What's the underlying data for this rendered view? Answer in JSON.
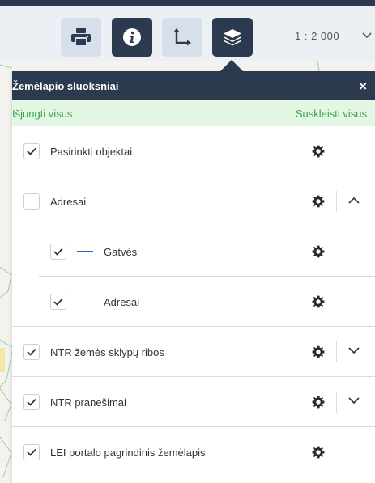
{
  "toolbar": {
    "tools": [
      {
        "icon": "printer-icon"
      },
      {
        "icon": "info-icon"
      },
      {
        "icon": "measure-icon"
      },
      {
        "icon": "layers-icon"
      }
    ],
    "scale_value": "1 : 2 000",
    "scale_icon": "chevron-down-icon"
  },
  "colors": {
    "header": "#2b3a4f",
    "accent_green": "#3aa34a",
    "actions_bg": "#e3f7e4",
    "street_line": "#2a6fb8"
  },
  "panel": {
    "title": "Žemėlapio sluoksniai",
    "close_label": "×",
    "turn_off_all": "Išjungti visus",
    "collapse_all": "Suskleisti visus",
    "layers": [
      {
        "label": "Pasirinkti objektai",
        "checked": true,
        "level": 0,
        "expander": "none"
      },
      {
        "label": "Adresai",
        "checked": false,
        "level": 0,
        "expander": "up"
      },
      {
        "label": "Gatvės",
        "checked": true,
        "level": 1,
        "expander": "none",
        "icon": "line-icon"
      },
      {
        "label": "Adresai",
        "checked": true,
        "level": 1,
        "expander": "none"
      },
      {
        "label": "NTR žemės sklypų ribos",
        "checked": true,
        "level": 0,
        "expander": "down"
      },
      {
        "label": "NTR pranešimai",
        "checked": true,
        "level": 0,
        "expander": "down"
      },
      {
        "label": "LEI portalo pagrindinis žemėlapis",
        "checked": true,
        "level": 0,
        "expander": "none"
      }
    ]
  }
}
